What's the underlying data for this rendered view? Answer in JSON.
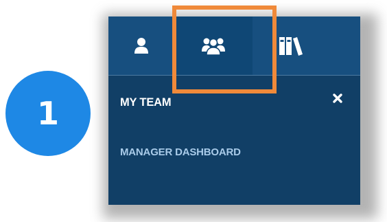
{
  "step": {
    "number": "1"
  },
  "tabs": [
    {
      "icon": "user-icon",
      "active": false
    },
    {
      "icon": "team-icon",
      "active": true
    },
    {
      "icon": "library-icon",
      "active": false
    }
  ],
  "panel": {
    "title": "MY TEAM",
    "close_icon": "close-icon",
    "links": [
      {
        "label": "MANAGER DASHBOARD"
      }
    ]
  },
  "colors": {
    "panel_bg": "#113f66",
    "tabbar_bg": "#174f7f",
    "active_tab_bg": "#0f4775",
    "link_text": "#a9cbe9",
    "highlight": "#f08a3a",
    "step_badge": "#1e88e5"
  }
}
